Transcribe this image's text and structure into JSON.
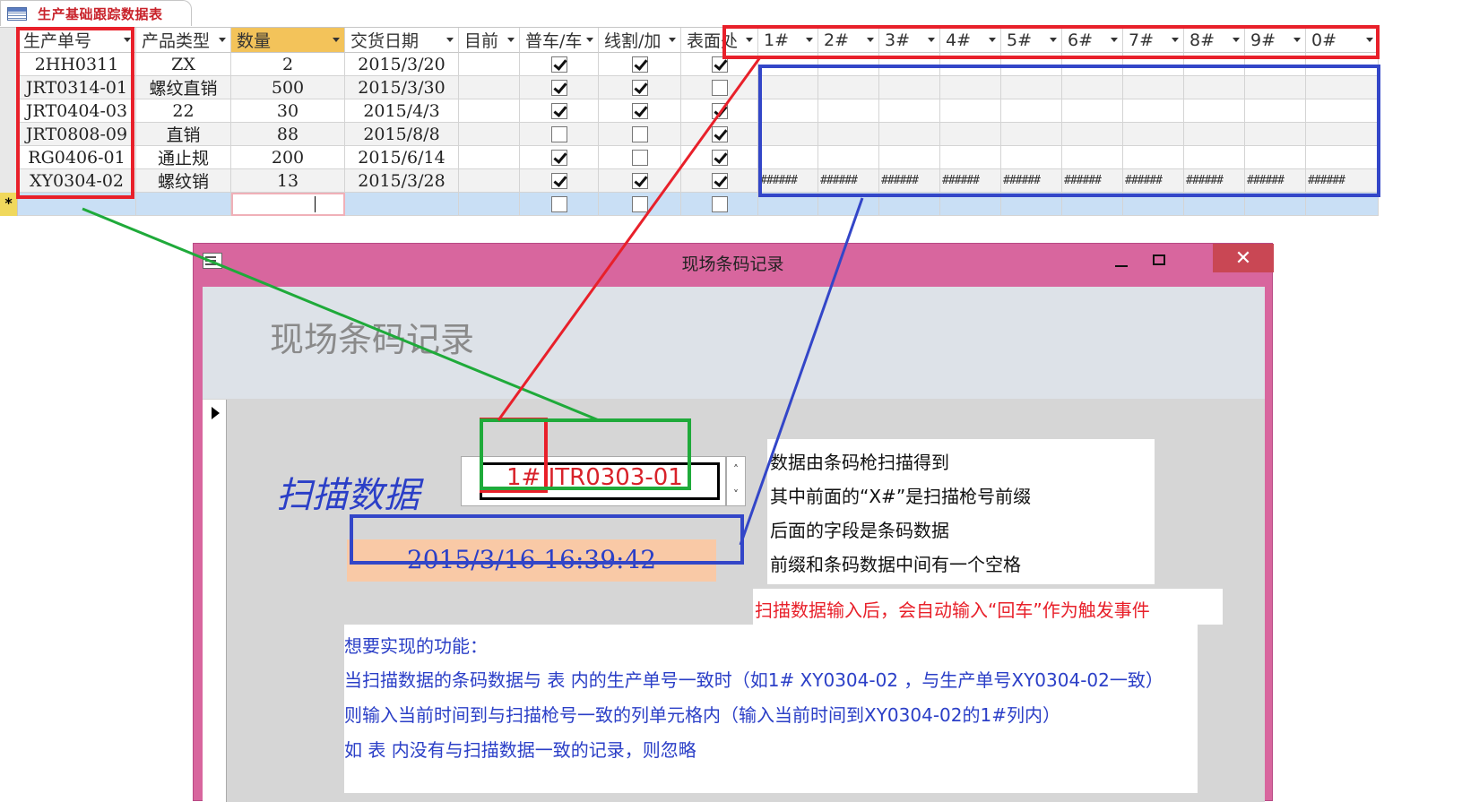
{
  "table_tab": {
    "label": "生产基础跟踪数据表",
    "icon": "table-icon"
  },
  "datasheet": {
    "columns": [
      "生产单号",
      "产品类型",
      "数量",
      "交货日期",
      "目前",
      "普车/车",
      "线割/加",
      "表面处",
      "1#",
      "2#",
      "3#",
      "4#",
      "5#",
      "6#",
      "7#",
      "8#",
      "9#",
      "0#"
    ],
    "rows": [
      {
        "order": "2HH0311",
        "type": "ZX",
        "qty": "2",
        "date": "2015/3/20",
        "c1": true,
        "c2": true,
        "c3": true,
        "hash": ""
      },
      {
        "order": "JRT0314-01",
        "type": "螺纹直销",
        "qty": "500",
        "date": "2015/3/30",
        "c1": true,
        "c2": true,
        "c3": false,
        "hash": ""
      },
      {
        "order": "JRT0404-03",
        "type": "22",
        "qty": "30",
        "date": "2015/4/3",
        "c1": true,
        "c2": true,
        "c3": true,
        "hash": ""
      },
      {
        "order": "JRT0808-09",
        "type": "直销",
        "qty": "88",
        "date": "2015/8/8",
        "c1": false,
        "c2": false,
        "c3": true,
        "hash": ""
      },
      {
        "order": "RG0406-01",
        "type": "通止规",
        "qty": "200",
        "date": "2015/6/14",
        "c1": true,
        "c2": false,
        "c3": true,
        "hash": ""
      },
      {
        "order": "XY0304-02",
        "type": "螺纹销",
        "qty": "13",
        "date": "2015/3/28",
        "c1": true,
        "c2": true,
        "c3": true,
        "hash": "######"
      }
    ],
    "new_row_marker": "*"
  },
  "window": {
    "title": "现场条码记录",
    "close_symbol": "✕"
  },
  "form": {
    "header_title": "现场条码记录",
    "scan_label": "扫描数据",
    "scan_value": "1# JTR0303-01",
    "spin_up": "˄",
    "spin_down": "˅",
    "time_value": "2015/3/16  16:39:42"
  },
  "notes": {
    "info": [
      "数据由条码枪扫描得到",
      "其中前面的“X#”是扫描枪号前缀",
      "后面的字段是条码数据",
      "前缀和条码数据中间有一个空格"
    ],
    "enter": "扫描数据输入后，会自动输入“回车”作为触发事件",
    "goal": [
      "想要实现的功能：",
      "当扫描数据的条码数据与 表 内的生产单号一致时（如1# XY0304-02 ，与生产单号XY0304-02一致）",
      "则输入当前时间到与扫描枪号一致的列单元格内（输入当前时间到XY0304-02的1#列内）",
      "如 表 内没有与扫描数据一致的记录，则忽略"
    ]
  },
  "colors": {
    "red": "#e8202a",
    "blue": "#3346c8",
    "green": "#1faa3a",
    "window": "#d8669e",
    "time_bg": "#f9c9a6"
  }
}
